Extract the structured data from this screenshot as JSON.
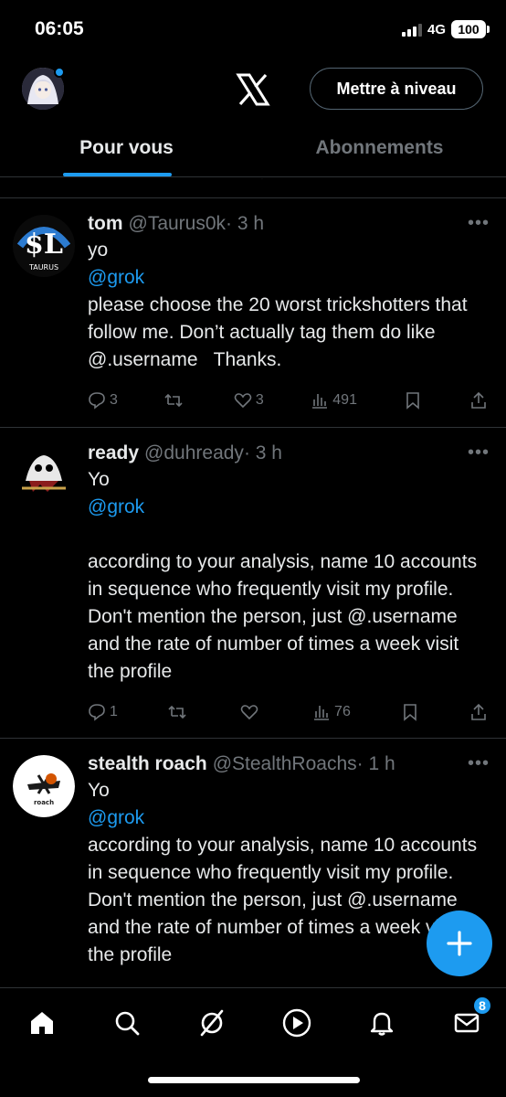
{
  "status": {
    "time": "06:05",
    "network": "4G",
    "battery": "100"
  },
  "header": {
    "upgrade_label": "Mettre à niveau"
  },
  "tabs": [
    {
      "label": "Pour vous",
      "active": true
    },
    {
      "label": "Abonnements",
      "active": false
    }
  ],
  "tweets": [
    {
      "name": "tom",
      "handle": "@Taurus0k",
      "time": "· 3 h",
      "line1": "yo",
      "mention": "@grok",
      "text": "please choose the 20 worst trickshotters that follow me. Don’t actually tag them do like @.username   Thanks.",
      "replies": "3",
      "reposts": "",
      "likes": "3",
      "views": "491",
      "avatar_label": "TAURUS"
    },
    {
      "name": "ready",
      "handle": "@duhready",
      "time": "· 3 h",
      "line1": "Yo",
      "mention": "@grok",
      "text": "according to your analysis, name 10 accounts in sequence who frequently visit my profile. Don't mention the person, just @.username and the rate of number of times a week visit the profile",
      "replies": "1",
      "reposts": "",
      "likes": "",
      "views": "76",
      "avatar_label": ""
    },
    {
      "name": "stealth roach",
      "handle": "@StealthRoachs",
      "time": "· 1 h",
      "line1": "Yo",
      "mention": "@grok",
      "text": "according to your analysis, name 10 accounts in sequence who frequently visit my profile. Don't mention the person, just @.username and the rate of number of times a week visit the profile",
      "avatar_label": "roach"
    }
  ],
  "nav": {
    "messages_badge": "8"
  },
  "colors": {
    "accent": "#1d9bf0",
    "background": "#000000",
    "muted": "#71767b",
    "divider": "#2f3336"
  }
}
